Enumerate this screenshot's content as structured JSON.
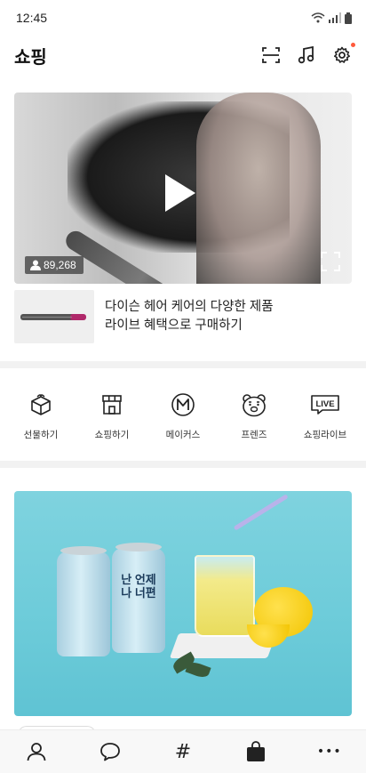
{
  "status_bar": {
    "time": "12:45"
  },
  "header": {
    "title": "쇼핑"
  },
  "live_card": {
    "viewer_count": "89,268"
  },
  "product": {
    "line1": "다이슨 헤어 케어의 다양한 제품",
    "line2": "라이브 혜택으로 구매하기"
  },
  "categories": [
    {
      "label": "선물하기",
      "icon": "gift-box-icon"
    },
    {
      "label": "쇼핑하기",
      "icon": "store-icon"
    },
    {
      "label": "메이커스",
      "icon": "makers-m-icon"
    },
    {
      "label": "프렌즈",
      "icon": "friends-bear-icon"
    },
    {
      "label": "쇼핑라이브",
      "icon": "live-icon"
    }
  ],
  "live_badge_text": "LIVE",
  "banner": {
    "can1_text": "",
    "can2_text": "난 언제나 너편"
  },
  "bottom_nav": {
    "hash": "#",
    "more": "•••"
  },
  "colors": {
    "accent_dot": "#ff5a3c",
    "banner_bg": "#6ccbd9",
    "divider": "#f2f2f2"
  }
}
